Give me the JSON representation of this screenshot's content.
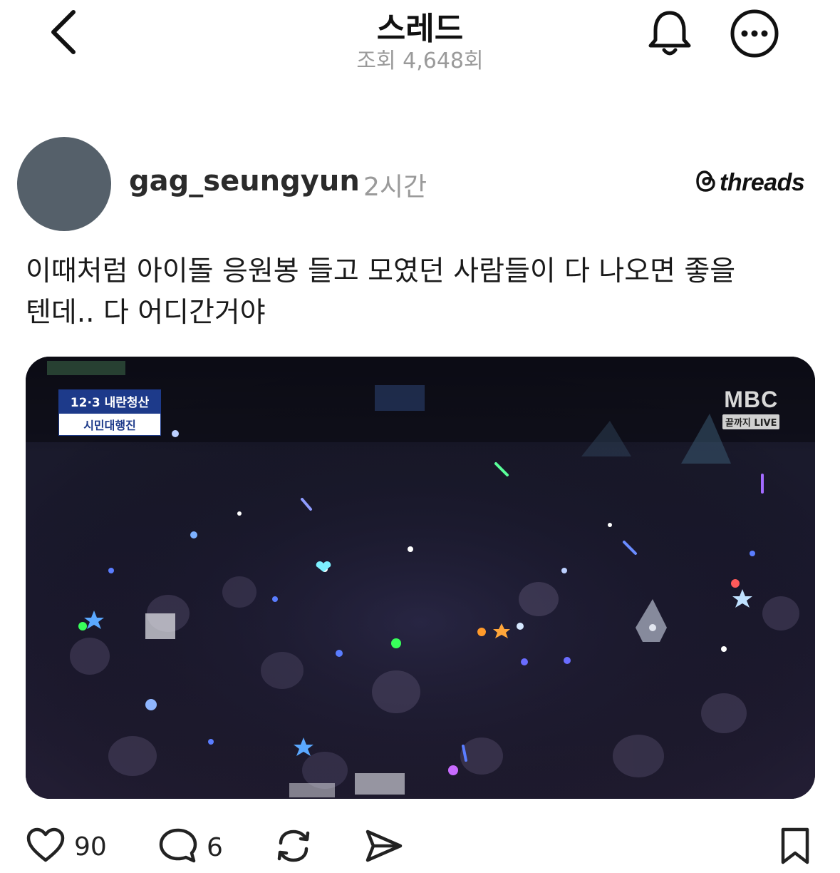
{
  "header": {
    "title": "스레드",
    "views": "조회 4,648회"
  },
  "post": {
    "username": "gag_seungyun",
    "time": "2시간",
    "brand": "threads",
    "text_line1": "이때처럼  아이돌 응원봉 들고 모였던 사람들이 다 나오면 좋을",
    "text_line2": "텐데.. 다 어디간거야",
    "media": {
      "tag_top": "12·3 내란청산",
      "tag_bottom": "시민대행진",
      "broadcaster": "MBC",
      "broadcaster_sub": "끝까지 LIVE"
    }
  },
  "actions": {
    "likes": "90",
    "comments": "6"
  },
  "icons": {
    "back": "chevron-left-icon",
    "bell": "bell-icon",
    "more": "more-icon",
    "like": "heart-icon",
    "comment": "comment-icon",
    "repost": "repost-icon",
    "share": "send-icon",
    "save": "bookmark-icon"
  }
}
